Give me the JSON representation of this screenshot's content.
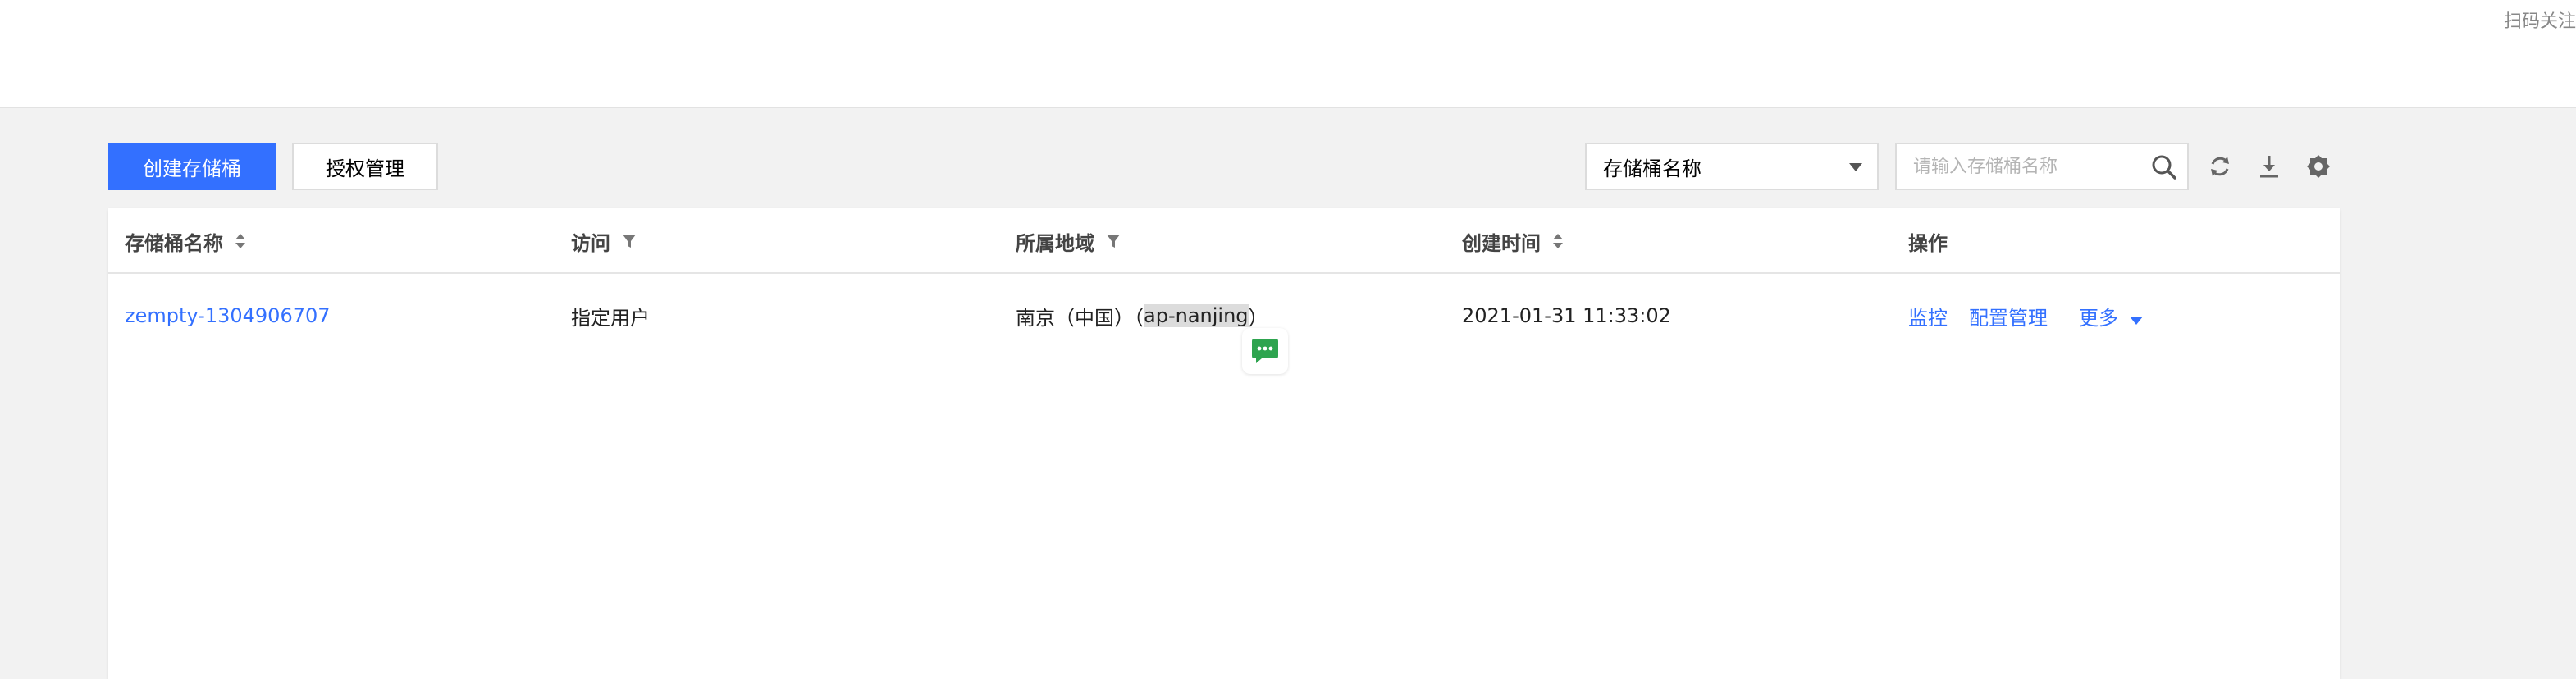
{
  "topbar": {
    "scan_text": "扫码关注"
  },
  "toolbar": {
    "create_label": "创建存储桶",
    "auth_label": "授权管理",
    "filter_select_value": "存储桶名称",
    "search_placeholder": "请输入存储桶名称"
  },
  "table": {
    "columns": [
      "存储桶名称",
      "访问",
      "所属地域",
      "创建时间",
      "操作"
    ],
    "rows": [
      {
        "name": "zempty-1304906707",
        "access": "指定用户",
        "region_prefix": "南京（中国）（",
        "region_code": "ap-nanjing",
        "region_suffix": "）",
        "created": "2021-01-31 11:33:02",
        "actions": [
          "监控",
          "配置管理",
          "更多"
        ]
      }
    ]
  },
  "colors": {
    "primary": "#3370ff",
    "background": "#f2f2f2"
  },
  "icons": [
    "search-icon",
    "refresh-icon",
    "download-icon",
    "settings-icon",
    "sort-icon",
    "filter-icon",
    "chat-icon",
    "caret-down-icon"
  ]
}
